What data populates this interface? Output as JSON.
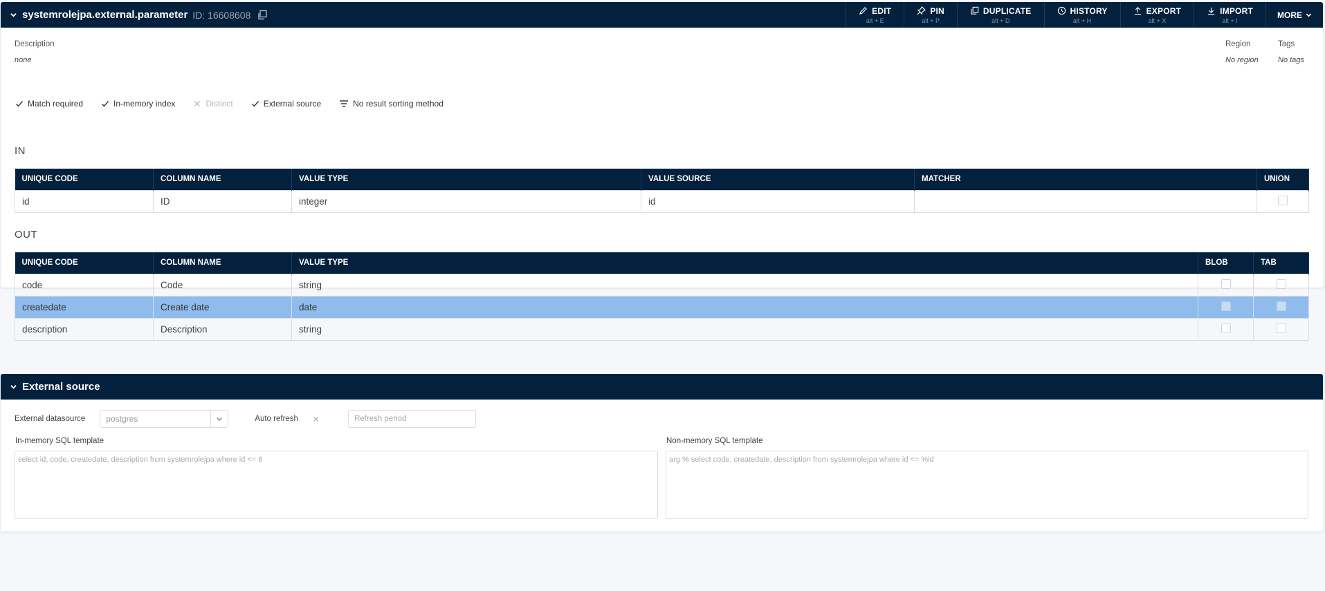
{
  "header": {
    "title": "systemrolejpa.external.parameter",
    "id_label": "ID: 16608608",
    "toolbar": [
      {
        "label": "EDIT",
        "shortcut": "alt + E",
        "icon": "pencil-icon"
      },
      {
        "label": "PIN",
        "shortcut": "alt + P",
        "icon": "pin-icon"
      },
      {
        "label": "DUPLICATE",
        "shortcut": "alt + D",
        "icon": "duplicate-icon"
      },
      {
        "label": "HISTORY",
        "shortcut": "alt + H",
        "icon": "history-icon"
      },
      {
        "label": "EXPORT",
        "shortcut": "alt + X",
        "icon": "export-icon"
      },
      {
        "label": "IMPORT",
        "shortcut": "alt + I",
        "icon": "import-icon"
      }
    ],
    "more_label": "MORE"
  },
  "info": {
    "description_label": "Description",
    "description_value": "none",
    "region_label": "Region",
    "region_value": "No region",
    "tags_label": "Tags",
    "tags_value": "No tags"
  },
  "flags": [
    {
      "label": "Match required",
      "enabled": true
    },
    {
      "label": "In-memory index",
      "enabled": true
    },
    {
      "label": "Distinct",
      "enabled": false
    },
    {
      "label": "External source",
      "enabled": true
    },
    {
      "label": "No result sorting method",
      "enabled": true
    }
  ],
  "in_section": {
    "title": "IN",
    "columns": [
      "UNIQUE CODE",
      "COLUMN NAME",
      "VALUE TYPE",
      "VALUE SOURCE",
      "MATCHER",
      "UNION"
    ],
    "rows": [
      {
        "code": "id",
        "name": "ID",
        "type": "integer",
        "source": "id",
        "matcher": ""
      }
    ]
  },
  "out_section": {
    "title": "OUT",
    "columns": [
      "UNIQUE CODE",
      "COLUMN NAME",
      "VALUE TYPE",
      "BLOB",
      "TAB"
    ],
    "rows": [
      {
        "code": "code",
        "name": "Code",
        "type": "string",
        "selected": false
      },
      {
        "code": "createdate",
        "name": "Create date",
        "type": "date",
        "selected": true
      },
      {
        "code": "description",
        "name": "Description",
        "type": "string",
        "selected": false
      }
    ]
  },
  "external": {
    "title": "External source",
    "datasource_label": "External datasource",
    "datasource_value": "postgres",
    "auto_refresh_label": "Auto refresh",
    "refresh_placeholder": "Refresh period",
    "inmem_label": "In-memory SQL template",
    "inmem_value": "select id, code, createdate, description from systemrolejpa where id <= 8",
    "noninmem_label": "Non-memory SQL template",
    "noninmem_value": "arg % select code, createdate, description from systemrolejpa where id <= %id"
  },
  "colors": {
    "header_bg": "#03213d",
    "selected_row": "#8fbcec",
    "page_bg": "#f5f7fb"
  }
}
